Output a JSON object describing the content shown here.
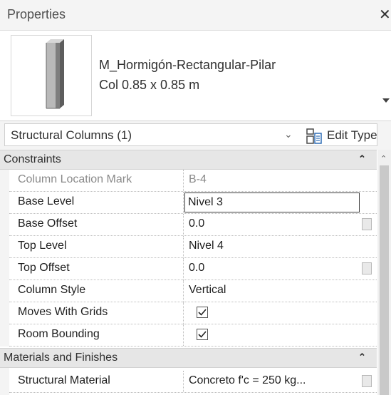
{
  "window": {
    "title": "Properties",
    "close_glyph": "✕"
  },
  "type_selector": {
    "family_name": "M_Hormigón-Rectangular-Pilar",
    "type_name": "Col 0.85 x 0.85 m",
    "thumbnail_icon": "column-preview-icon",
    "dropdown_icon": "caret-down-icon"
  },
  "filter": {
    "category": "Structural Columns (1)",
    "chevron": "⌄",
    "edit_type_label": "Edit Type",
    "edit_type_icon": "edit-type-icon"
  },
  "groups": [
    {
      "label": "Constraints",
      "collapse_glyph": "⌃"
    },
    {
      "label": "Materials and Finishes",
      "collapse_glyph": "⌃"
    }
  ],
  "properties": [
    {
      "name": "Column Location Mark",
      "value": "B-4",
      "readonly": true
    },
    {
      "name": "Base Level",
      "value": "Nivel 3",
      "editing": true
    },
    {
      "name": "Base Offset",
      "value": "0.0",
      "param_button": true
    },
    {
      "name": "Top Level",
      "value": "Nivel 4"
    },
    {
      "name": "Top Offset",
      "value": "0.0",
      "param_button": true
    },
    {
      "name": "Column Style",
      "value": "Vertical"
    },
    {
      "name": "Moves With Grids",
      "checked": true
    },
    {
      "name": "Room Bounding",
      "checked": true
    },
    {
      "name": "Structural Material",
      "value": "Concreto f'c = 250 kg...",
      "param_button": true
    }
  ],
  "scrollbar": {
    "up_glyph": "⌃"
  },
  "colors": {
    "accent": "#3c3c3c",
    "group_header": "#e6e6e6",
    "muted_text": "#8a8a8a"
  }
}
